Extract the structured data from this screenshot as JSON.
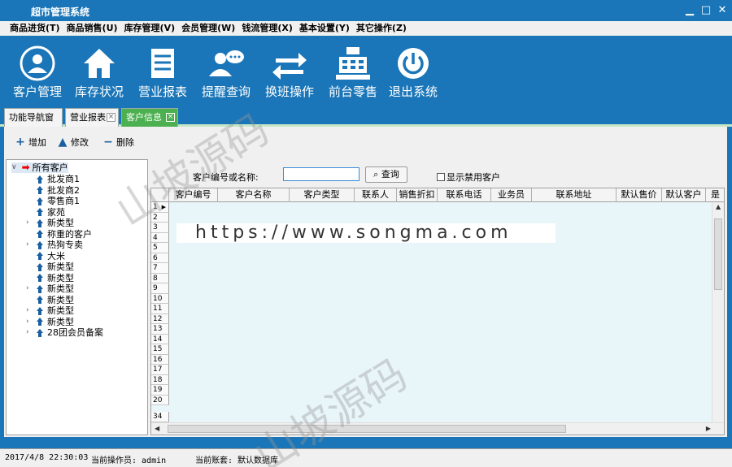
{
  "window": {
    "title": "超市管理系统"
  },
  "menu": [
    "商品进货(T)",
    "商品销售(U)",
    "库存管理(V)",
    "会员管理(W)",
    "钱流管理(X)",
    "基本设置(Y)",
    "其它操作(Z)"
  ],
  "toolbar": [
    {
      "label": "客户管理",
      "icon": "user-icon"
    },
    {
      "label": "库存状况",
      "icon": "home-icon"
    },
    {
      "label": "营业报表",
      "icon": "report-icon"
    },
    {
      "label": "提醒查询",
      "icon": "chat-user-icon"
    },
    {
      "label": "换班操作",
      "icon": "swap-icon"
    },
    {
      "label": "前台零售",
      "icon": "cash-register-icon"
    },
    {
      "label": "退出系统",
      "icon": "power-icon"
    }
  ],
  "tabs": [
    {
      "label": "功能导航窗口",
      "closable": false,
      "active": false
    },
    {
      "label": "营业报表",
      "closable": true,
      "active": false
    },
    {
      "label": "客户信息",
      "closable": true,
      "active": true
    }
  ],
  "actions": {
    "add": "增加",
    "edit": "修改",
    "delete": "删除"
  },
  "tree": {
    "root": "所有客户",
    "items": [
      {
        "label": "批发商1",
        "expandable": false
      },
      {
        "label": "批发商2",
        "expandable": false
      },
      {
        "label": "零售商1",
        "expandable": false
      },
      {
        "label": "家苑",
        "expandable": false
      },
      {
        "label": "新类型",
        "expandable": true
      },
      {
        "label": "称重的客户",
        "expandable": false
      },
      {
        "label": "热狗专卖",
        "expandable": true
      },
      {
        "label": "大米",
        "expandable": false
      },
      {
        "label": "新类型",
        "expandable": false
      },
      {
        "label": "新类型",
        "expandable": false
      },
      {
        "label": "新类型",
        "expandable": true
      },
      {
        "label": "新类型",
        "expandable": false
      },
      {
        "label": "新类型",
        "expandable": true
      },
      {
        "label": "新类型",
        "expandable": true
      },
      {
        "label": "28团会员备案",
        "expandable": true
      }
    ]
  },
  "search": {
    "label": "客户编号或名称:",
    "value": "",
    "button": "查询",
    "checkbox_label": "显示禁用客户",
    "checked": false
  },
  "grid": {
    "columns": [
      "客户编号",
      "客户名称",
      "客户类型",
      "联系人",
      "销售折扣",
      "联系电话",
      "业务员",
      "联系地址",
      "默认售价",
      "默认客户",
      "是"
    ],
    "row_numbers": [
      "1",
      "2",
      "3",
      "4",
      "5",
      "6",
      "7",
      "8",
      "9",
      "10",
      "11",
      "12",
      "13",
      "14",
      "15",
      "16",
      "17",
      "18",
      "19",
      "20",
      "34"
    ]
  },
  "overlay": {
    "url": "https://www.songma.com",
    "watermark": "山坡源码"
  },
  "status": {
    "datetime": "2017/4/8 22:30:03",
    "operator": "当前操作员: admin",
    "account": "当前账套: 默认数据库"
  }
}
